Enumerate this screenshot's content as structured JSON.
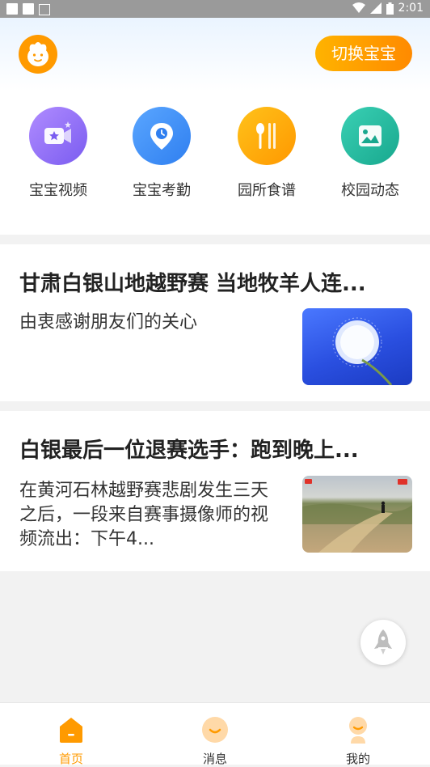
{
  "status_bar": {
    "time": "2:01"
  },
  "header": {
    "switch_label": "切换宝宝"
  },
  "menu": [
    {
      "label": "宝宝视频",
      "icon": "video-star-icon",
      "color": "#8b6cf0"
    },
    {
      "label": "宝宝考勤",
      "icon": "location-clock-icon",
      "color": "#3a8cf5"
    },
    {
      "label": "园所食谱",
      "icon": "spoon-fork-icon",
      "color": "#ffaa00"
    },
    {
      "label": "校园动态",
      "icon": "picture-icon",
      "color": "#22b8a0"
    }
  ],
  "news": [
    {
      "title": "甘肃白银山地越野赛 当地牧羊人连...",
      "desc": "由衷感谢朋友们的关心",
      "thumb": "dandelion-image"
    },
    {
      "title": "白银最后一位退赛选手：跑到晚上...",
      "desc": "在黄河石林越野赛悲剧发生三天之后，一段来自赛事摄像师的视频流出：下午4...",
      "thumb": "trail-runner-image"
    }
  ],
  "tabs": [
    {
      "label": "首页",
      "icon": "home-icon",
      "active": true
    },
    {
      "label": "消息",
      "icon": "message-icon",
      "active": false
    },
    {
      "label": "我的",
      "icon": "profile-icon",
      "active": false
    }
  ],
  "colors": {
    "accent": "#ff9a00",
    "inactive": "#333333"
  }
}
